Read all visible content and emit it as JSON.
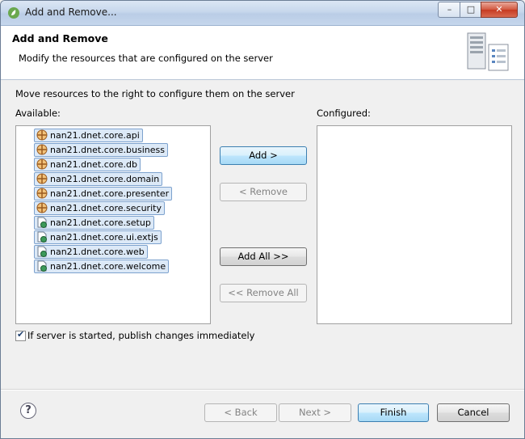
{
  "window": {
    "title": "Add and Remove..."
  },
  "header": {
    "title": "Add and Remove",
    "description": "Modify the resources that are configured on the server"
  },
  "instructions": "Move resources to the right to configure them on the server",
  "available": {
    "label": "Available:",
    "items": [
      {
        "label": "nan21.dnet.core.api",
        "icon": "module-icon"
      },
      {
        "label": "nan21.dnet.core.business",
        "icon": "module-icon"
      },
      {
        "label": "nan21.dnet.core.db",
        "icon": "module-icon"
      },
      {
        "label": "nan21.dnet.core.domain",
        "icon": "module-icon"
      },
      {
        "label": "nan21.dnet.core.presenter",
        "icon": "module-icon"
      },
      {
        "label": "nan21.dnet.core.security",
        "icon": "module-icon"
      },
      {
        "label": "nan21.dnet.core.setup",
        "icon": "web-project-icon"
      },
      {
        "label": "nan21.dnet.core.ui.extjs",
        "icon": "web-project-icon"
      },
      {
        "label": "nan21.dnet.core.web",
        "icon": "web-project-icon"
      },
      {
        "label": "nan21.dnet.core.welcome",
        "icon": "web-project-icon"
      }
    ]
  },
  "configured": {
    "label": "Configured:",
    "items": []
  },
  "buttons": {
    "add": "Add >",
    "remove": "< Remove",
    "add_all": "Add All >>",
    "remove_all": "<< Remove All",
    "back": "< Back",
    "next": "Next >",
    "finish": "Finish",
    "cancel": "Cancel"
  },
  "publish_option": {
    "label": "If server is started, publish changes immediately",
    "checked": true
  },
  "colors": {
    "selection": "#dce9f7",
    "selection_border": "#7da2ce",
    "primary_button": "#bee6fd"
  }
}
